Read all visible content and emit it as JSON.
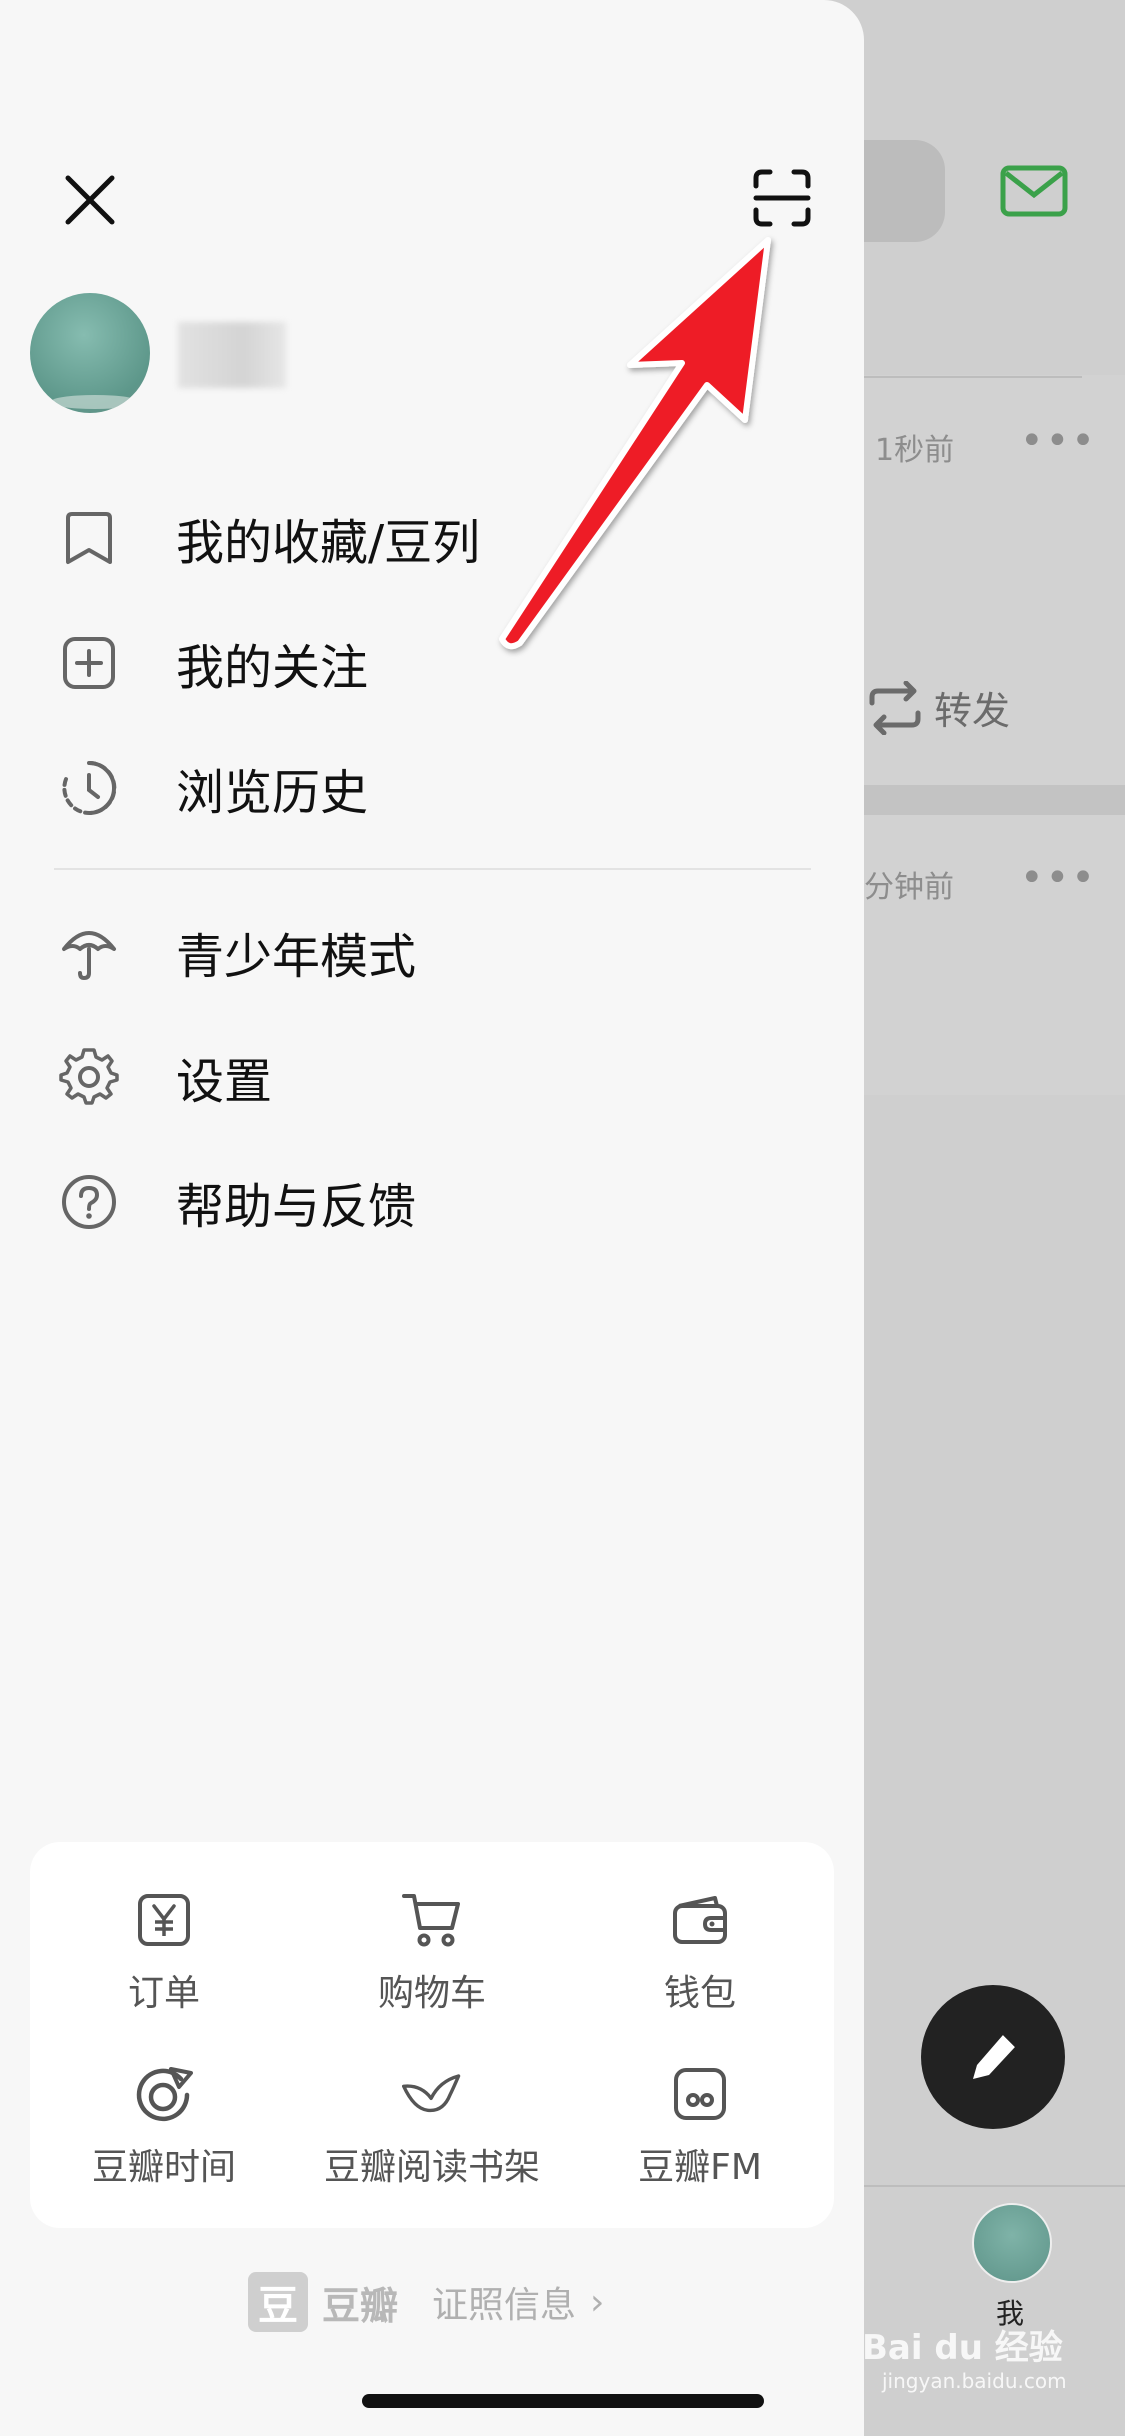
{
  "background": {
    "feed_items": [
      {
        "time": "1秒前",
        "more": "•••"
      },
      {
        "time": "分钟前",
        "more": "•••"
      }
    ],
    "repost_label": "转发",
    "tabbar_me_label": "我",
    "watermark_main": "Bai du 经验",
    "watermark_sub": "jingyan.baidu.com"
  },
  "drawer": {
    "menu": [
      {
        "label": "我的收藏/豆列",
        "icon": "bookmark-icon"
      },
      {
        "label": "我的关注",
        "icon": "plus-square-icon"
      },
      {
        "label": "浏览历史",
        "icon": "history-clock-icon"
      }
    ],
    "menu2": [
      {
        "label": "青少年模式",
        "icon": "umbrella-icon"
      },
      {
        "label": "设置",
        "icon": "gear-icon"
      },
      {
        "label": "帮助与反馈",
        "icon": "help-circle-icon"
      }
    ],
    "quick": [
      {
        "label": "订单",
        "icon": "yen-order-icon"
      },
      {
        "label": "购物车",
        "icon": "cart-icon"
      },
      {
        "label": "钱包",
        "icon": "wallet-icon"
      },
      {
        "label": "豆瓣时间",
        "icon": "douban-time-icon"
      },
      {
        "label": "豆瓣阅读书架",
        "icon": "bird-icon"
      },
      {
        "label": "豆瓣FM",
        "icon": "fm-icon"
      }
    ],
    "footer": {
      "logo_char": "豆",
      "brand": "豆瓣",
      "license": "证照信息",
      "chevron": "›"
    }
  },
  "colors": {
    "accent_green": "#3ba14a",
    "arrow_red": "#ee1c25"
  }
}
